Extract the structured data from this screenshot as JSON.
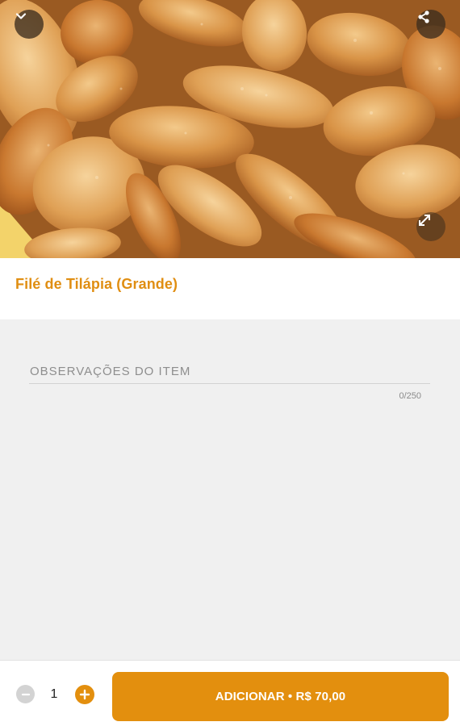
{
  "item": {
    "title": "Filé de Tilápia (Grande)",
    "image_subject": "fried-tilapia-fillets"
  },
  "header_icons": {
    "collapse": "chevron-down-icon",
    "share": "share-icon",
    "expand": "expand-icon"
  },
  "notes": {
    "placeholder": "OBSERVAÇÕES DO ITEM",
    "value": "",
    "counter": "0/250"
  },
  "order": {
    "quantity": "1",
    "add_label": "ADICIONAR • R$ 70,00"
  },
  "colors": {
    "accent": "#e38f0e",
    "title": "#e08e12",
    "notes_background": "#f0f0f0",
    "minus_disabled": "#d3d3d3"
  }
}
